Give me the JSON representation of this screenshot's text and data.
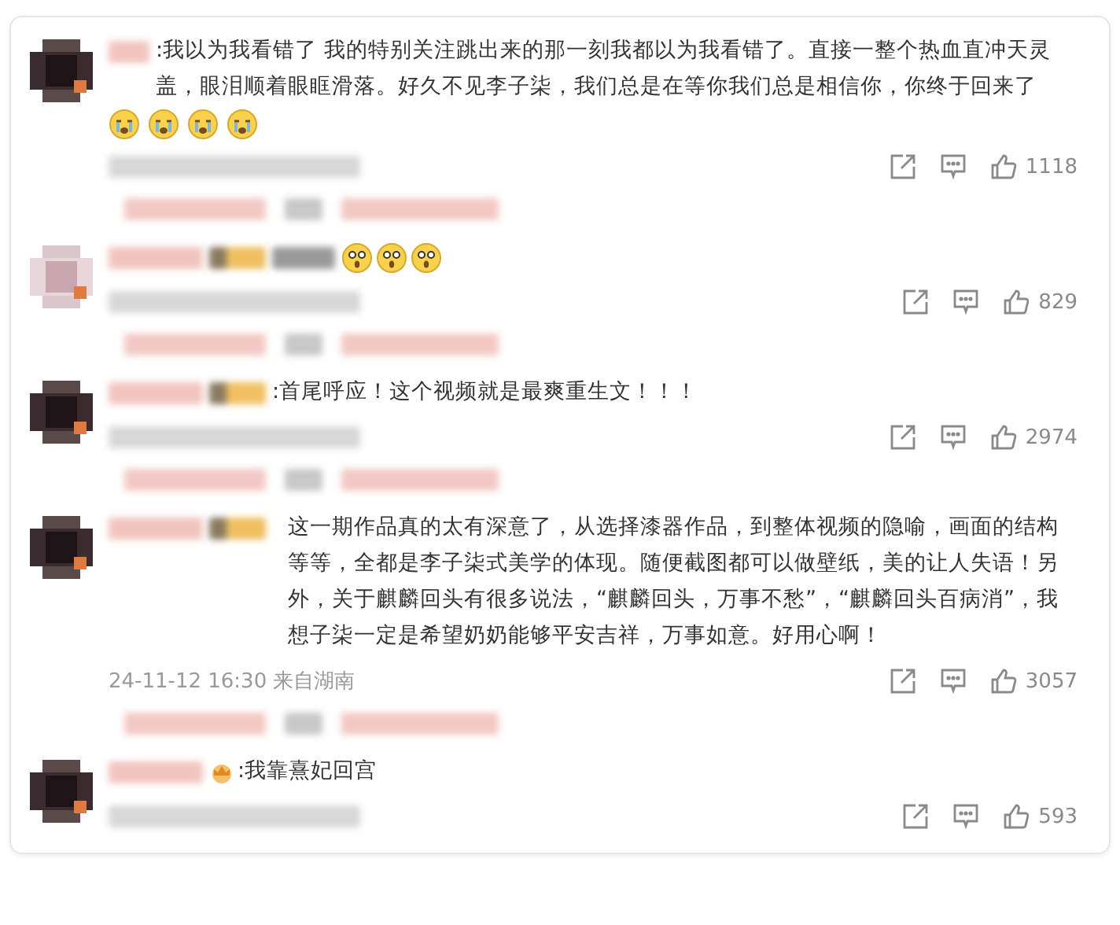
{
  "comments": [
    {
      "text": ":我以为我看错了 我的特别关注跳出来的那一刻我都以为我看错了。直接一整个热血直冲天灵盖，眼泪顺着眼眶滑落。好久不见李子柒，我们总是在等你我们总是相信你，你终于回来了",
      "badge": {
        "kind": "none"
      },
      "emojis": [
        {
          "kind": "crying"
        },
        {
          "kind": "crying"
        },
        {
          "kind": "crying"
        },
        {
          "kind": "crying"
        }
      ],
      "likes": "1118",
      "reply_preview": true
    },
    {
      "badge": {
        "kind": "redacted"
      },
      "emojis": [
        {
          "kind": "surprised"
        },
        {
          "kind": "surprised"
        },
        {
          "kind": "surprised"
        }
      ],
      "likes": "829",
      "reply_preview": true
    },
    {
      "text": ":首尾呼应！这个视频就是最爽重生文！！！",
      "badge": {
        "kind": "redacted"
      },
      "likes": "2974",
      "reply_preview": true
    },
    {
      "text": "这一期作品真的太有深意了，从选择漆器作品，到整体视频的隐喻，画面的结构等等，全都是李子柒式美学的体现。随便截图都可以做壁纸，美的让人失语！另外，关于麒麟回头有很多说法，“麒麟回头，万事不愁”，“麒麟回头百病消”，我想子柒一定是希望奶奶能够平安吉祥，万事如意。好用心啊！",
      "badge": {
        "kind": "redacted"
      },
      "timestamp": "24-11-12 16:30 来自湖南",
      "likes": "3057",
      "reply_preview": true
    },
    {
      "text": ":我靠熹妃回宫",
      "badge": {
        "kind": "crown"
      },
      "likes": "593",
      "reply_preview": false
    }
  ]
}
